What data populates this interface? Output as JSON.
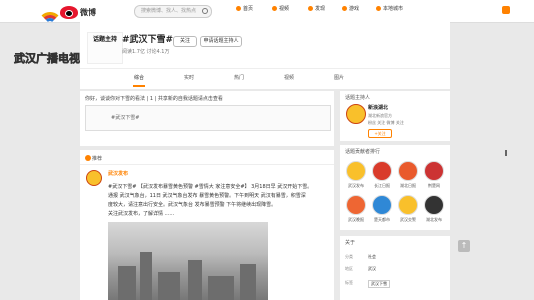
{
  "topbar": {
    "logo_text": "微博",
    "search_placeholder": "搜索微博、找人、找热点",
    "nav": [
      "首页",
      "视频",
      "发现",
      "游戏",
      "本地城市"
    ]
  },
  "overlay": {
    "station_name": "武汉广播电视台"
  },
  "topic": {
    "badge": "话题主持",
    "title": "#武汉下雪#",
    "stats": "阅读1.7亿  讨论4.1万",
    "follow_label": "关注",
    "host_label": "申请话题主持人"
  },
  "tabs": [
    "综合",
    "实时",
    "热门",
    "视频",
    "图片"
  ],
  "composer": {
    "hint": "你好，谈谈你对下雪的看法 | 1 | 共享新的自我话题请点击查看",
    "content": "#武汉下雪#"
  },
  "post": {
    "header": "推荐",
    "author": "武汉发布",
    "lines": [
      "#武汉下雪# 【武汉发布暴雪黄色预警 #雪情大 家注意安全#】 3月18日早  武汉开始下雪。",
      "通报 武汉气象台，11日 武汉气象台发布 暴雪黄色预警。下午到明天 武汉有暴雪，积雪深",
      "度较大，请注意出行安全。武汉气象台 发布暴雪预警 下午将继续出现降雪。",
      "关注武汉发布，了解详情 ......"
    ]
  },
  "sidebar": {
    "featured_title": "话题主持人",
    "featured_name": "新浪湖北",
    "featured_desc_1": "湖北新浪官方",
    "featured_desc_2": "粉丝 关注 微博 关注",
    "follow_label": "+关注",
    "ranking_title": "话题贡献者排行",
    "ranking": [
      "武汉发布",
      "长江日报",
      "湖北日报",
      "荆楚网",
      "武汉晚报",
      "楚天都市",
      "武汉交警",
      "湖北发布"
    ],
    "about_title": "关于",
    "about": [
      {
        "label": "分类",
        "value": "社会"
      },
      {
        "label": "地区",
        "value": "武汉"
      },
      {
        "label": "标签",
        "value": "武汉下雪"
      }
    ]
  }
}
